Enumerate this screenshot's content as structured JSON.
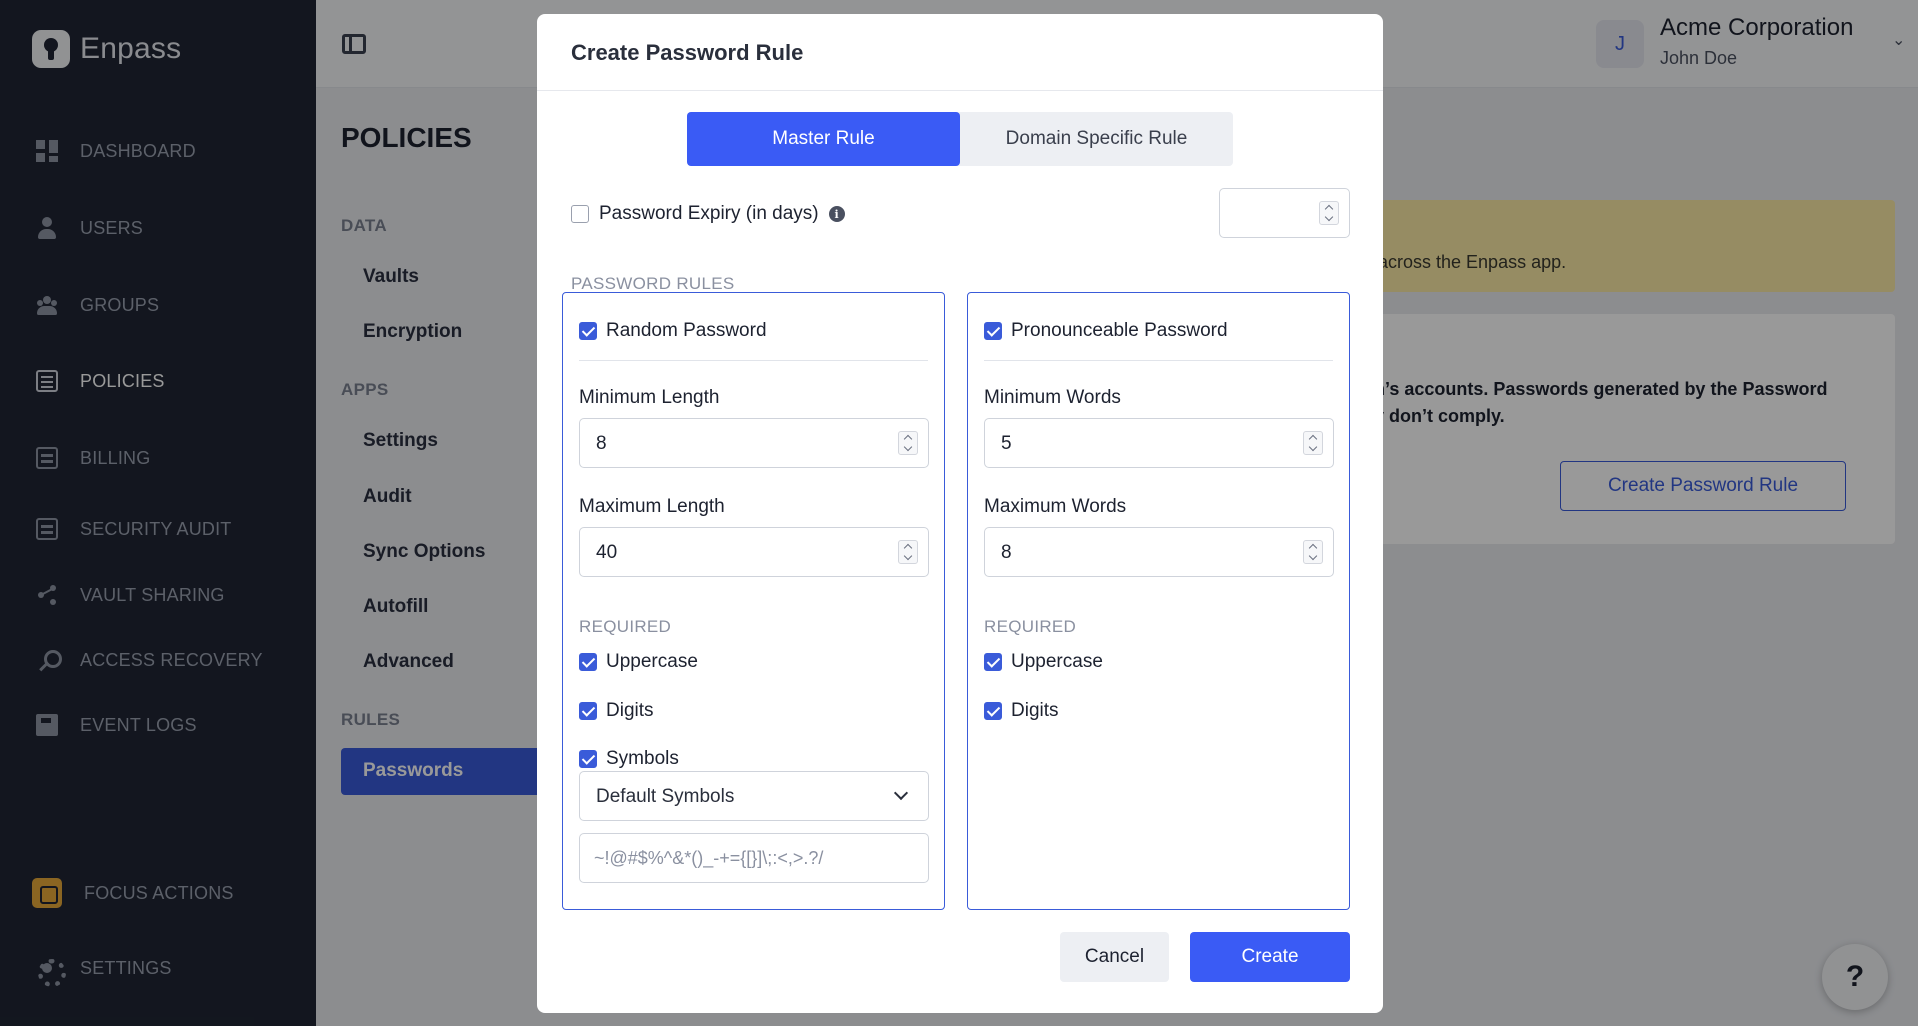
{
  "brand": {
    "name": "Enpass"
  },
  "sidebar": {
    "items": [
      {
        "label": "DASHBOARD",
        "icon": "dashboard-icon"
      },
      {
        "label": "USERS",
        "icon": "user-icon"
      },
      {
        "label": "GROUPS",
        "icon": "groups-icon"
      },
      {
        "label": "POLICIES",
        "icon": "policies-icon",
        "active": true
      },
      {
        "label": "BILLING",
        "icon": "billing-icon"
      },
      {
        "label": "SECURITY AUDIT",
        "icon": "security-audit-icon"
      },
      {
        "label": "VAULT SHARING",
        "icon": "share-icon"
      },
      {
        "label": "ACCESS RECOVERY",
        "icon": "key-icon"
      },
      {
        "label": "EVENT LOGS",
        "icon": "book-icon"
      }
    ],
    "bottom": [
      {
        "label": "FOCUS ACTIONS",
        "icon": "focus-actions-icon"
      },
      {
        "label": "SETTINGS",
        "icon": "gear-icon"
      }
    ]
  },
  "topbar": {
    "org_initial": "J",
    "org_name": "Acme Corporation",
    "user_name": "John Doe"
  },
  "page": {
    "title": "POLICIES",
    "sections": [
      {
        "label": "DATA",
        "items": [
          "Vaults",
          "Encryption"
        ]
      },
      {
        "label": "APPS",
        "items": [
          "Settings",
          "Audit",
          "Sync Options",
          "Autofill",
          "Advanced"
        ]
      },
      {
        "label": "RULES",
        "items": [
          "Passwords"
        ]
      }
    ],
    "notice_text": "across the Enpass app.",
    "card_text": "n’s accounts. Passwords generated by the Password ",
    "card_text_2": "y don’t comply.",
    "card_button": "Create Password Rule",
    "help": "?"
  },
  "modal": {
    "title": "Create Password Rule",
    "tabs": [
      {
        "label": "Master Rule",
        "active": true
      },
      {
        "label": "Domain Specific Rule",
        "active": false
      }
    ],
    "expiry": {
      "label": "Password Expiry (in days)",
      "checked": false,
      "value": ""
    },
    "rules_label": "PASSWORD RULES",
    "random": {
      "title": "Random Password",
      "checked": true,
      "min_label": "Minimum Length",
      "min_value": "8",
      "max_label": "Maximum Length",
      "max_value": "40",
      "required_label": "REQUIRED",
      "uppercase": "Uppercase",
      "digits": "Digits",
      "symbols": "Symbols",
      "symbols_select": "Default Symbols",
      "symbols_value": "~!@#$%^&*()_-+={[}]\\;:<,>.?/"
    },
    "pronounceable": {
      "title": "Pronounceable Password",
      "checked": true,
      "min_label": "Minimum Words",
      "min_value": "5",
      "max_label": "Maximum Words",
      "max_value": "8",
      "required_label": "REQUIRED",
      "uppercase": "Uppercase",
      "digits": "Digits"
    },
    "cancel": "Cancel",
    "create": "Create"
  },
  "colors": {
    "sidebar_bg": "#202634",
    "accent": "#3a5bf5",
    "notice_bg": "#fbe9a6"
  }
}
